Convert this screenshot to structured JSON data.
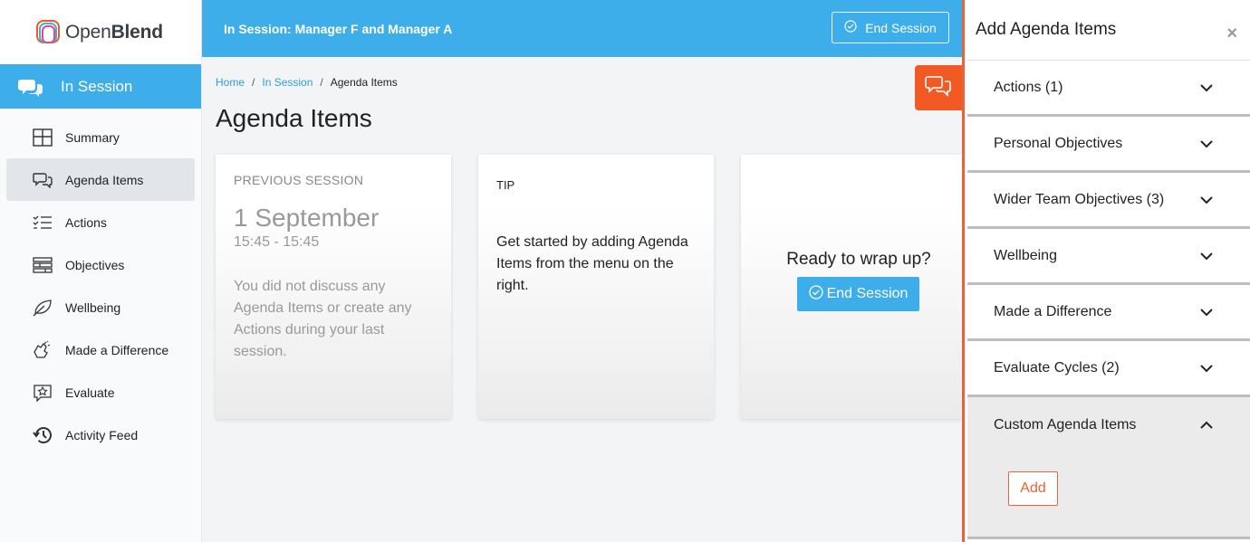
{
  "app": {
    "brand_first": "Open",
    "brand_second": "Blend"
  },
  "sidebar": {
    "section": "In Session",
    "items": [
      {
        "label": "Summary",
        "icon": "grid-icon"
      },
      {
        "label": "Agenda Items",
        "icon": "chat-bubbles-icon"
      },
      {
        "label": "Actions",
        "icon": "checklist-icon"
      },
      {
        "label": "Objectives",
        "icon": "layers-icon"
      },
      {
        "label": "Wellbeing",
        "icon": "leaf-icon"
      },
      {
        "label": "Made a Difference",
        "icon": "clap-icon"
      },
      {
        "label": "Evaluate",
        "icon": "star-icon"
      },
      {
        "label": "Activity Feed",
        "icon": "history-icon"
      }
    ]
  },
  "topbar": {
    "prefix": "In Session:",
    "participants": "Manager F and Manager A",
    "end_session": "End Session"
  },
  "breadcrumb": {
    "home": "Home",
    "in_session": "In Session",
    "current": "Agenda Items"
  },
  "page": {
    "title": "Agenda Items"
  },
  "cards": {
    "previous": {
      "label": "PREVIOUS SESSION",
      "date": "1 September",
      "time": "15:45 - 15:45",
      "text": "You did not discuss any Agenda Items or create any Actions during your last session."
    },
    "tip": {
      "label": "TIP",
      "text": "Get started by adding Agenda Items from the menu on the right."
    },
    "wrap": {
      "question": "Ready to wrap up?",
      "button": "End Session"
    }
  },
  "panel": {
    "title": "Add Agenda Items",
    "close": "×",
    "sections": [
      {
        "label": "Actions (1)"
      },
      {
        "label": "Personal Objectives"
      },
      {
        "label": "Wider Team Objectives (3)"
      },
      {
        "label": "Wellbeing"
      },
      {
        "label": "Made a Difference"
      },
      {
        "label": "Evaluate Cycles (2)"
      }
    ],
    "custom": {
      "label": "Custom Agenda Items",
      "add": "Add"
    }
  },
  "colors": {
    "accent": "#3daee9",
    "orange": "#f15a24"
  }
}
